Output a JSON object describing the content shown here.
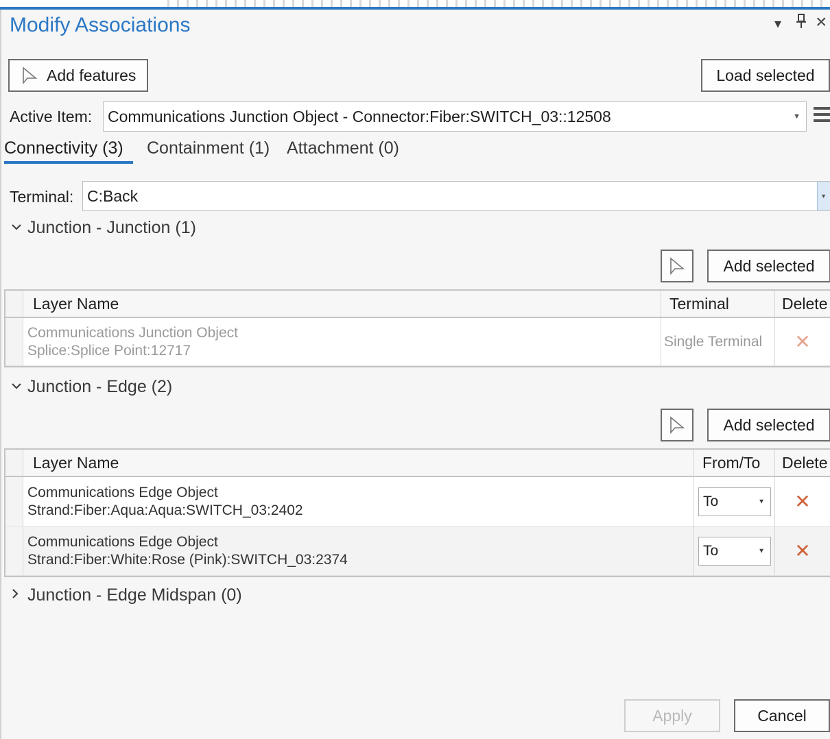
{
  "window": {
    "title": "Modify Associations",
    "controls": {
      "dropdown": "▾",
      "pin": "⊥",
      "close": "×"
    }
  },
  "toolbar": {
    "add_features_label": "Add features",
    "load_selected_label": "Load selected"
  },
  "active_item": {
    "label": "Active Item:",
    "value": "Communications Junction Object - Connector:Fiber:SWITCH_03::12508"
  },
  "tabs": [
    {
      "label": "Connectivity (3)",
      "selected": true
    },
    {
      "label": "Containment (1)",
      "selected": false
    },
    {
      "label": "Attachment (0)",
      "selected": false
    }
  ],
  "terminal": {
    "label": "Terminal:",
    "value": "C:Back"
  },
  "sections": {
    "jj": {
      "title": "Junction - Junction (1)",
      "add_selected_label": "Add selected",
      "headers": {
        "layer": "Layer Name",
        "terminal": "Terminal",
        "delete": "Delete"
      },
      "rows": [
        {
          "line1": "Communications Junction Object",
          "line2": "Splice:Splice Point:12717",
          "terminal": "Single Terminal"
        }
      ]
    },
    "je": {
      "title": "Junction - Edge (2)",
      "add_selected_label": "Add selected",
      "headers": {
        "layer": "Layer Name",
        "fromto": "From/To",
        "delete": "Delete"
      },
      "rows": [
        {
          "line1": "Communications Edge Object",
          "line2": "Strand:Fiber:Aqua:Aqua:SWITCH_03:2402",
          "fromto": "To"
        },
        {
          "line1": "Communications Edge Object",
          "line2": "Strand:Fiber:White:Rose (Pink):SWITCH_03:2374",
          "fromto": "To"
        }
      ]
    },
    "jem": {
      "title": "Junction - Edge Midspan (0)"
    }
  },
  "footer": {
    "apply_label": "Apply",
    "cancel_label": "Cancel"
  },
  "colors": {
    "accent": "#2b78c5",
    "delete": "#d0623a"
  }
}
